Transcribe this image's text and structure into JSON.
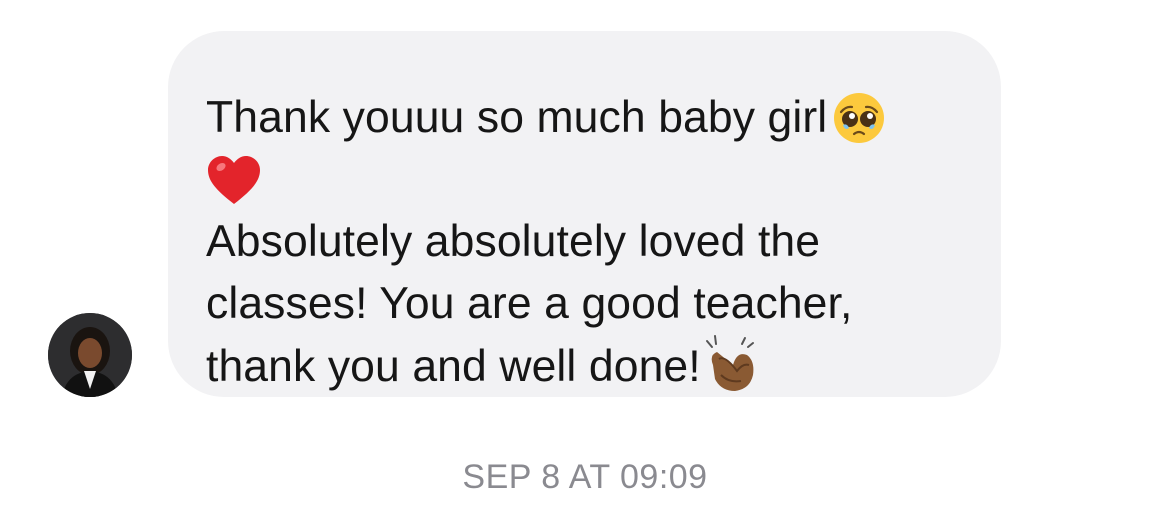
{
  "conversation": {
    "message": {
      "sender_avatar": "avatar-photo",
      "line1": "Thank youuu so much baby girl",
      "emoji1": "pleading-face-icon",
      "emoji2": "red-heart-icon",
      "line2": "Absolutely absolutely loved the",
      "line3": "classes! You are a good teacher,",
      "line4": "thank you and well done!",
      "emoji3": "clapping-hands-icon"
    },
    "timestamp": "SEP 8 AT 09:09"
  },
  "colors": {
    "bubble_background": "#f2f2f4",
    "message_text": "#161616",
    "timestamp_text": "#8a8a90"
  }
}
